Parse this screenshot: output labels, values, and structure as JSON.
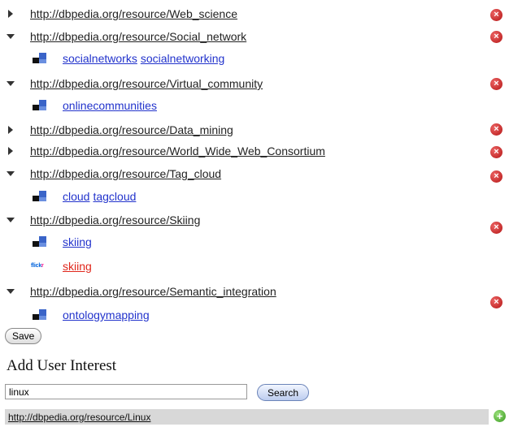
{
  "resources": [
    {
      "uri": "http://dbpedia.org/resource/Web_science",
      "expanded": false,
      "tags": []
    },
    {
      "uri": "http://dbpedia.org/resource/Social_network",
      "expanded": true,
      "tags": [
        {
          "source": "delicious",
          "links": [
            "socialnetworks",
            "socialnetworking"
          ]
        }
      ]
    },
    {
      "uri": "http://dbpedia.org/resource/Virtual_community",
      "expanded": true,
      "tags": [
        {
          "source": "delicious",
          "links": [
            "onlinecommunities"
          ]
        }
      ]
    },
    {
      "uri": "http://dbpedia.org/resource/Data_mining",
      "expanded": false,
      "tags": []
    },
    {
      "uri": "http://dbpedia.org/resource/World_Wide_Web_Consortium",
      "expanded": false,
      "tags": []
    },
    {
      "uri": "http://dbpedia.org/resource/Tag_cloud",
      "expanded": true,
      "tags": [
        {
          "source": "delicious",
          "links": [
            "cloud",
            "tagcloud"
          ]
        }
      ]
    },
    {
      "uri": "http://dbpedia.org/resource/Skiing",
      "expanded": true,
      "tags": [
        {
          "source": "delicious",
          "links": [
            "skiing"
          ]
        },
        {
          "source": "flickr",
          "links": [
            "skiing"
          ]
        }
      ]
    },
    {
      "uri": "http://dbpedia.org/resource/Semantic_integration",
      "expanded": true,
      "tags": [
        {
          "source": "delicious",
          "links": [
            "ontologymapping"
          ]
        }
      ]
    }
  ],
  "icons": {
    "expand_collapsed": "triangle-right-icon",
    "expand_open": "triangle-down-icon",
    "delete": "delete-icon",
    "add": "add-icon"
  },
  "flickr_logo": {
    "fl": "flick",
    "kr": "r"
  },
  "save_label": "Save",
  "add_interest": {
    "title": "Add User Interest",
    "search_value": "linux",
    "search_label": "Search",
    "result_uri": "http://dbpedia.org/resource/Linux"
  },
  "colors": {
    "delete": "#c0211b",
    "add": "#4caf30",
    "tag_link": "#2233cc",
    "flickr_link": "#e0261b"
  }
}
